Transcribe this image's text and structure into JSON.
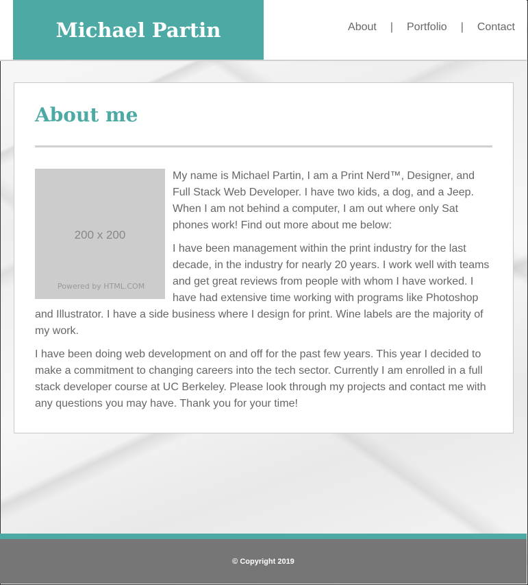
{
  "header": {
    "brand": "Michael Partin",
    "nav": {
      "about": "About",
      "separator": "|",
      "portfolio": "Portfolio",
      "contact": "Contact"
    }
  },
  "about": {
    "title": "About me",
    "image": {
      "dimensions": "200 x 200",
      "credit": "Powered by HTML.COM"
    },
    "paragraphs": [
      "My name is Michael Partin, I am a Print Nerd™, Designer, and Full Stack Web Developer. I have two kids, a dog, and a Jeep. When I am not behind a computer, I am out where only Sat phones work! Find out more about me below:",
      "I have been management within the print industry for the last decade, in the industry for nearly 20 years. I work well with teams and get great reviews from people with whom I have worked. I have had extensive time working with programs like Photoshop and Illustrator. I have a side business where I design for print. Wine labels are the majority of my work.",
      "I have been doing web development on and off for the past few years. This year I decided to make a commitment to changing careers into the tech sector. Currently I am enrolled in a full stack developer course at UC Berkeley. Please look through my projects and contact me with any questions you may have. Thank you for your time!"
    ]
  },
  "footer": {
    "copyright": "© Copyright 2019"
  },
  "colors": {
    "accent": "#4ca9a4",
    "footer_bg": "#767676",
    "text": "#666666"
  }
}
